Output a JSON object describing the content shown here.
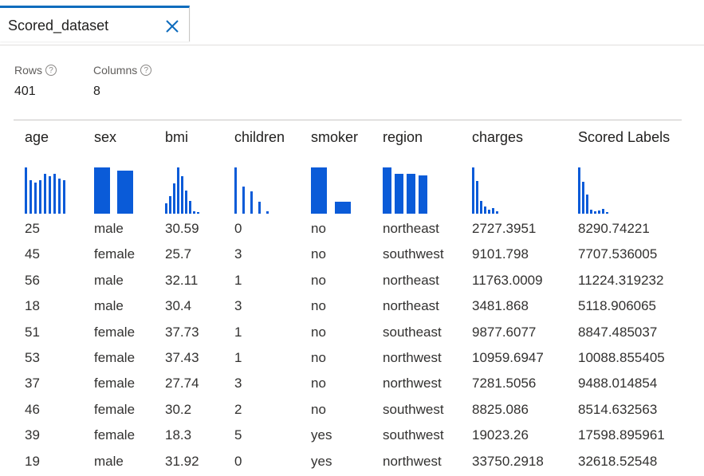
{
  "tab": {
    "title": "Scored_dataset"
  },
  "stats": {
    "rows_label": "Rows",
    "rows_value": "401",
    "columns_label": "Columns",
    "columns_value": "8"
  },
  "table": {
    "columns": [
      "age",
      "sex",
      "bmi",
      "children",
      "smoker",
      "region",
      "charges",
      "Scored Labels"
    ],
    "histograms": [
      [
        1.0,
        0.72,
        0.67,
        0.72,
        0.86,
        0.81,
        0.86,
        0.76,
        0.72
      ],
      [
        1.0,
        0.93
      ],
      [
        0.22,
        0.38,
        0.66,
        1.0,
        0.81,
        0.5,
        0.28,
        0.05,
        0.03
      ],
      [
        1.0,
        0.58,
        0.48,
        0.26,
        0.05
      ],
      [
        1.0,
        0.26
      ],
      [
        1.0,
        0.86,
        0.86,
        0.83
      ],
      [
        1.0,
        0.7,
        0.28,
        0.16,
        0.09,
        0.12,
        0.05
      ],
      [
        1.0,
        0.69,
        0.41,
        0.09,
        0.06,
        0.07,
        0.1,
        0.03
      ]
    ],
    "rows": [
      [
        "25",
        "male",
        "30.59",
        "0",
        "no",
        "northeast",
        "2727.3951",
        "8290.74221"
      ],
      [
        "45",
        "female",
        "25.7",
        "3",
        "no",
        "southwest",
        "9101.798",
        "7707.536005"
      ],
      [
        "56",
        "male",
        "32.11",
        "1",
        "no",
        "northeast",
        "11763.0009",
        "11224.319232"
      ],
      [
        "18",
        "male",
        "30.4",
        "3",
        "no",
        "northeast",
        "3481.868",
        "5118.906065"
      ],
      [
        "51",
        "female",
        "37.73",
        "1",
        "no",
        "southeast",
        "9877.6077",
        "8847.485037"
      ],
      [
        "53",
        "female",
        "37.43",
        "1",
        "no",
        "northwest",
        "10959.6947",
        "10088.855405"
      ],
      [
        "37",
        "female",
        "27.74",
        "3",
        "no",
        "northwest",
        "7281.5056",
        "9488.014854"
      ],
      [
        "46",
        "female",
        "30.2",
        "2",
        "no",
        "southwest",
        "8825.086",
        "8514.632563"
      ],
      [
        "39",
        "female",
        "18.3",
        "5",
        "yes",
        "southwest",
        "19023.26",
        "17598.895961"
      ],
      [
        "19",
        "male",
        "31.92",
        "0",
        "yes",
        "northwest",
        "33750.2918",
        "32618.52548"
      ]
    ]
  },
  "colors": {
    "accent": "#0f6cbd",
    "bar": "#0a5bd8"
  }
}
